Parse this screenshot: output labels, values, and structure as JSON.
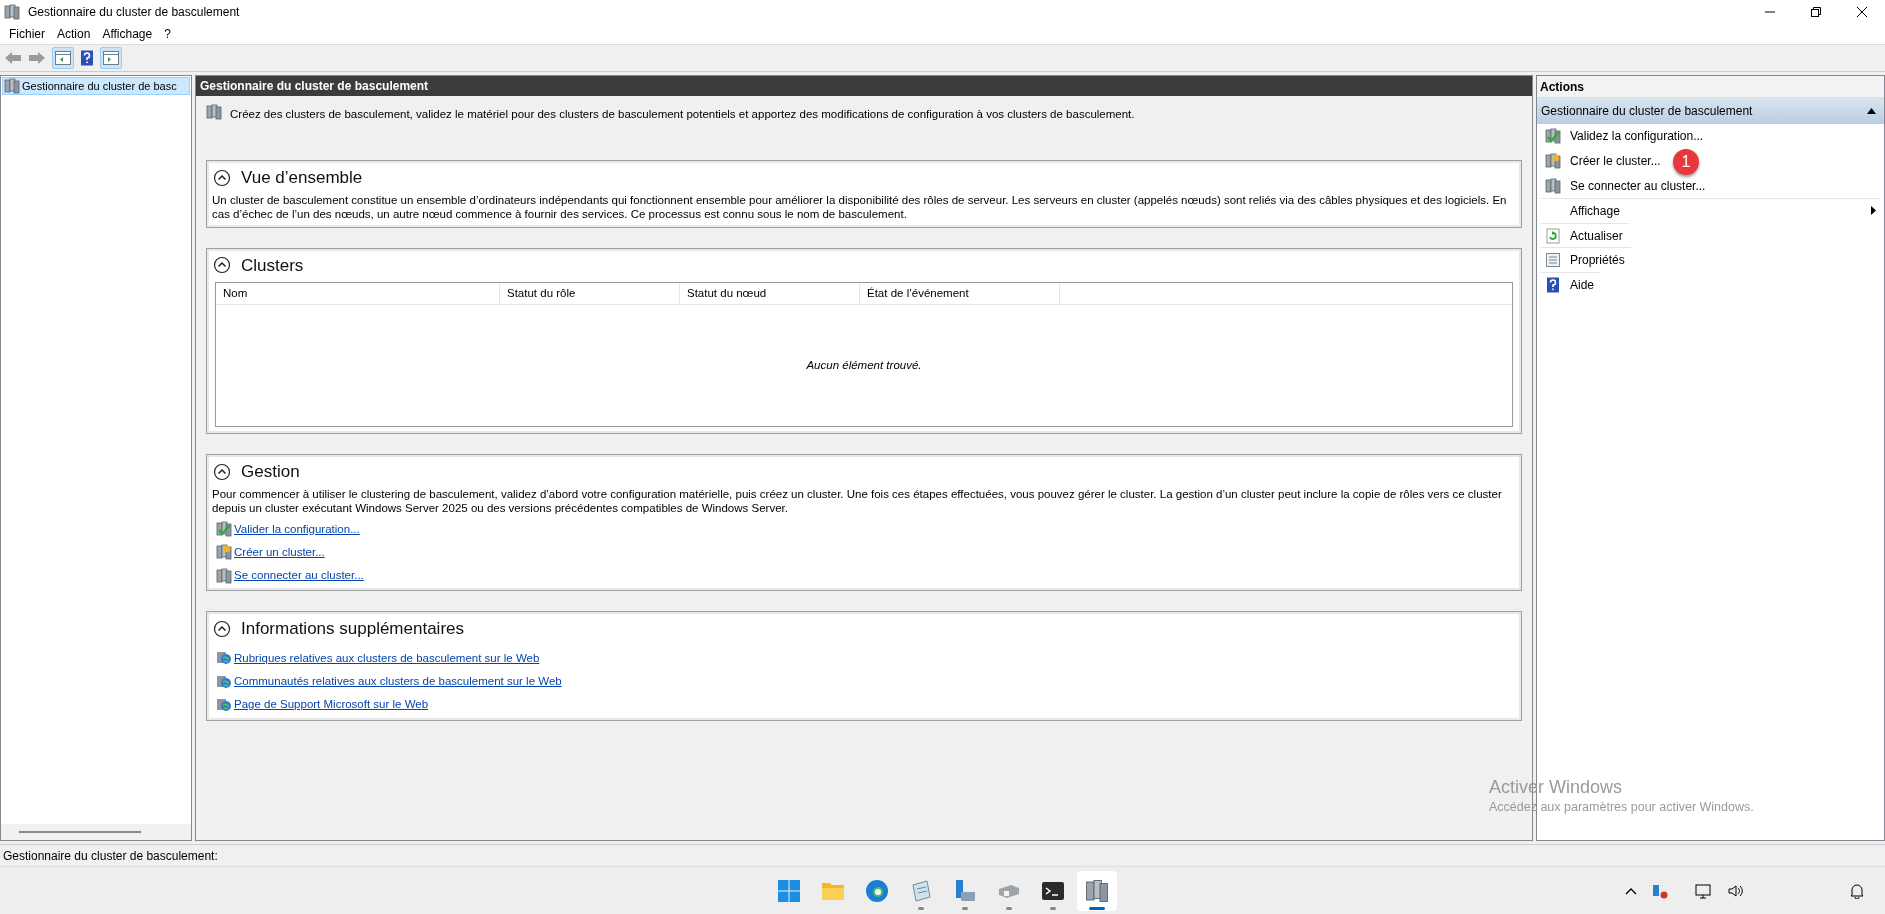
{
  "window": {
    "title": "Gestionnaire du cluster de basculement"
  },
  "menu": [
    "Fichier",
    "Action",
    "Affichage",
    "?"
  ],
  "toolbar": [
    {
      "kind": "back",
      "disabled": true
    },
    {
      "kind": "forward",
      "disabled": true
    },
    {
      "kind": "tree-pane",
      "pressed": true
    },
    {
      "kind": "help",
      "pressed": false
    },
    {
      "kind": "action-pane",
      "pressed": true
    }
  ],
  "tree": {
    "items": [
      {
        "label": "Gestionnaire du cluster de basc",
        "selected": true
      }
    ]
  },
  "main": {
    "header": "Gestionnaire du cluster de basculement",
    "intro": "Créez des clusters de basculement, validez le matériel pour des clusters de basculement potentiels et apportez des modifications de configuration à vos clusters de basculement.",
    "sections": [
      {
        "kind": "text",
        "title": "Vue d’ensemble",
        "expanded": true,
        "text": "Un cluster de basculement constitue un ensemble d’ordinateurs indépendants qui fonctionnent ensemble pour améliorer la disponibilité des rôles de serveur. Les serveurs en cluster (appelés nœuds) sont reliés via des câbles physiques et des logiciels. En cas d’échec de l’un des nœuds, un autre nœud commence à fournir des services. Ce processus est connu sous le nom de basculement."
      },
      {
        "kind": "table",
        "title": "Clusters",
        "expanded": true,
        "columns": [
          "Nom",
          "Statut du rôle",
          "Statut du nœud",
          "État de l’événement"
        ],
        "empty_message": "Aucun élément trouvé."
      },
      {
        "kind": "links",
        "title": "Gestion",
        "expanded": true,
        "text": "Pour commencer à utiliser le clustering de basculement, validez d’abord votre configuration matérielle, puis créez un cluster. Une fois ces étapes effectuées, vous pouvez gérer le cluster. La gestion d’un cluster peut inclure la copie de rôles vers ce cluster depuis un cluster exécutant Windows Server 2025 ou des versions précédentes compatibles de Windows Server.",
        "links": [
          {
            "kind": "validate",
            "label": "Valider la configuration..."
          },
          {
            "kind": "create",
            "label": "Créer un cluster..."
          },
          {
            "kind": "connect",
            "label": "Se connecter au cluster..."
          }
        ]
      },
      {
        "kind": "links",
        "title": "Informations supplémentaires",
        "expanded": true,
        "links": [
          {
            "kind": "web",
            "label": "Rubriques relatives aux clusters de basculement sur le Web"
          },
          {
            "kind": "web",
            "label": "Communautés relatives aux clusters de basculement sur le Web"
          },
          {
            "kind": "web",
            "label": "Page de Support Microsoft sur le Web"
          }
        ]
      }
    ]
  },
  "actions": {
    "title": "Actions",
    "group": {
      "label": "Gestionnaire du cluster de basculement",
      "expanded": true
    },
    "items": [
      {
        "kind": "validate",
        "label": "Validez la configuration..."
      },
      {
        "kind": "create",
        "label": "Créer le cluster...",
        "badge": "1"
      },
      {
        "kind": "connect",
        "label": "Se connecter au cluster..."
      },
      {
        "kind": "submenu",
        "label": "Affichage"
      },
      {
        "kind": "refresh",
        "label": "Actualiser"
      },
      {
        "kind": "properties",
        "label": "Propriétés"
      },
      {
        "kind": "help",
        "label": "Aide"
      }
    ]
  },
  "activation": {
    "title": "Activer Windows",
    "text": "Accédez aux paramètres pour activer Windows."
  },
  "status_bar": "Gestionnaire du cluster de basculement:",
  "taskbar": {
    "apps": [
      {
        "kind": "start",
        "running": false,
        "selected": false
      },
      {
        "kind": "folder",
        "running": false,
        "selected": false
      },
      {
        "kind": "browser",
        "running": false,
        "selected": false
      },
      {
        "kind": "notepad",
        "running": true,
        "selected": false
      },
      {
        "kind": "server",
        "running": true,
        "selected": false
      },
      {
        "kind": "device",
        "running": true,
        "selected": false
      },
      {
        "kind": "terminal",
        "running": true,
        "selected": false
      },
      {
        "kind": "cluster",
        "running": true,
        "selected": true
      }
    ]
  }
}
